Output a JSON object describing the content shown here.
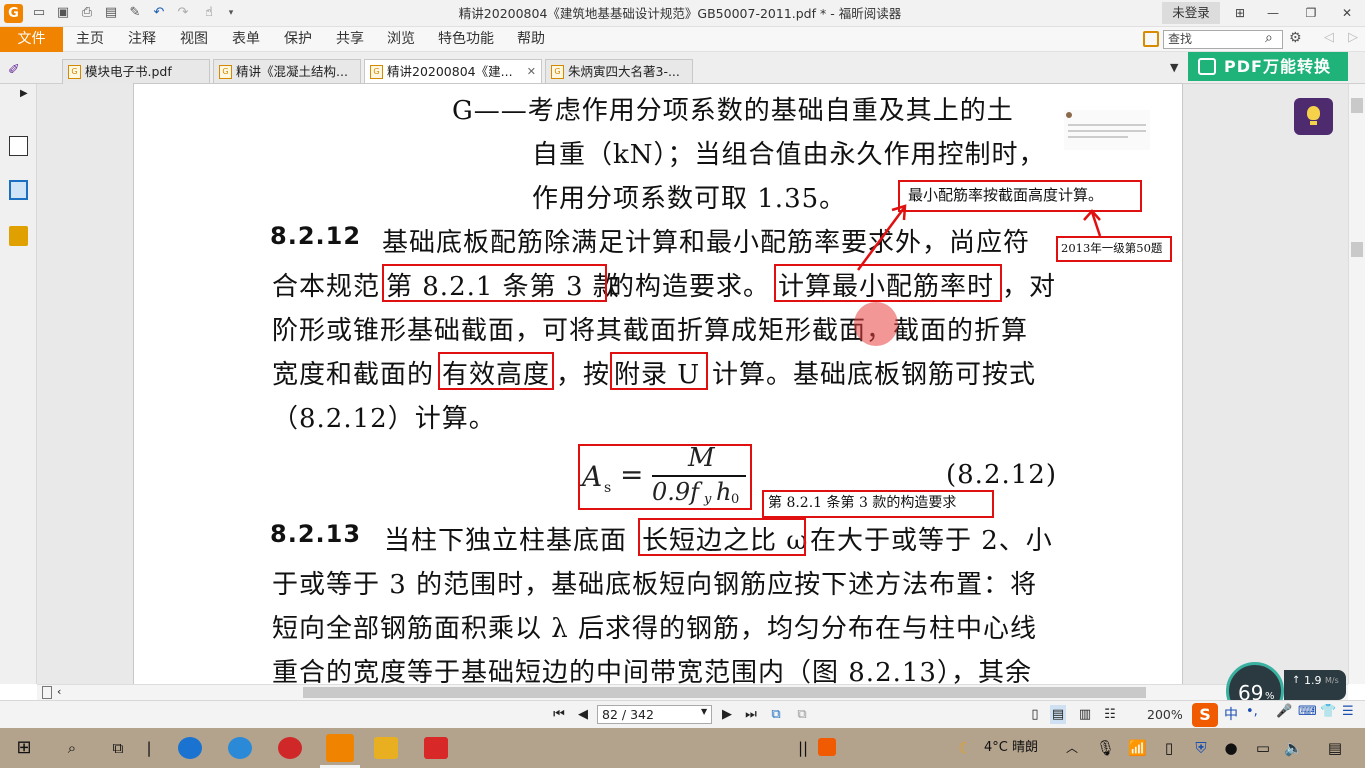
{
  "window": {
    "title": "精讲20200804《建筑地基基础设计规范》GB50007-2011.pdf * - 福昕阅读器",
    "login_label": "未登录"
  },
  "menu": {
    "file": "文件",
    "items": [
      "主页",
      "注释",
      "视图",
      "表单",
      "保护",
      "共享",
      "浏览",
      "特色功能",
      "帮助"
    ],
    "search_placeholder": "查找"
  },
  "tabs": [
    {
      "label": "模块电子书.pdf",
      "active": false
    },
    {
      "label": "精讲《混凝土结构...",
      "active": false
    },
    {
      "label": "精讲20200804《建...",
      "active": true
    },
    {
      "label": "朱炳寅四大名著3-...",
      "active": false
    }
  ],
  "pdf_convert_label": "PDF万能转换",
  "document": {
    "lines": [
      "G——考虑作用分项系数的基础自重及其上的土",
      "自重（kN）；当组合值由永久作用控制时，",
      "作用分项系数可取 1.35。",
      "8.2.12",
      "基础底板配筋除满足计算和最小配筋率要求外，尚应符",
      "合本规范",
      "第 8.2.1 条第 3 款",
      "的构造要求。",
      "计算最小配筋率时",
      "，对",
      "阶形或锥形基础截面，可将其截面折算成矩形截面，截面的折算",
      "宽度和截面的",
      "有效高度",
      "，按",
      "附录 U",
      "计算。基础底板钢筋可按式",
      "（8.2.12）计算。",
      "(8.2.12)",
      "8.2.13",
      "当柱下独立柱基底面",
      "长短边之比 ω",
      "在大于或等于 2、小",
      "于或等于 3 的范围时，基础底板短向钢筋应按下述方法布置：将",
      "短向全部钢筋面积乘以 λ 后求得的钢筋，均匀分布在与柱中心线",
      "重合的宽度等于基础短边的中间带宽范围内（图 8.2.13），其余"
    ],
    "formula": {
      "lhs": "A",
      "lhs_sub": "s",
      "eq": "=",
      "num": "M",
      "den": "0.9f",
      "den_sub1": "y",
      "den_h": "h",
      "den_sub2": "0"
    },
    "annotations": {
      "min_ratio_note": "最小配筋率按截面高度计算。",
      "exam_note": "2013年一级第50题",
      "clause_note": "第 8.2.1 条第 3 款的构造要求"
    }
  },
  "statusbar": {
    "page_value": "82 / 342",
    "zoom": "200%"
  },
  "overlay": {
    "percent": "69",
    "percent_unit": "%",
    "speed": "1.9",
    "speed_unit": "M/s"
  },
  "taskbar": {
    "weather": "4°C  晴朗",
    "ime": "中"
  },
  "colors": {
    "accent_orange": "#f08300",
    "annotation_red": "#e01010",
    "convert_green": "#1fb37a"
  }
}
